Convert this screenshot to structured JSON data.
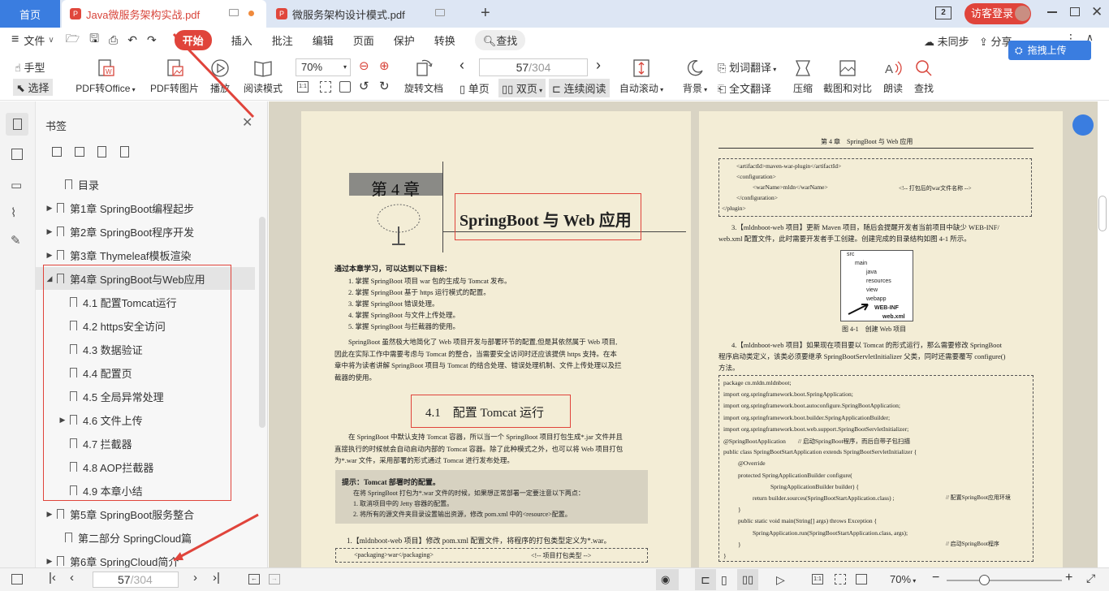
{
  "tabs": {
    "home": "首页",
    "active": "Java微服务架构实战.pdf",
    "second": "微服务架构设计模式.pdf",
    "badge": "2",
    "login": "访客登录"
  },
  "menu": {
    "file": "文件",
    "start": "开始",
    "insert": "插入",
    "annotate": "批注",
    "edit": "编辑",
    "page": "页面",
    "protect": "保护",
    "convert": "转换",
    "search": "查找",
    "unsynced": "未同步",
    "share": "分享"
  },
  "toolbar": {
    "hand": "手型",
    "select": "选择",
    "pdf_office": "PDF转Office",
    "pdf_image": "PDF转图片",
    "play": "播放",
    "read_mode": "阅读模式",
    "zoom": "70%",
    "rotate": "旋转文档",
    "page_current": "57",
    "page_total": "/304",
    "single": "单页",
    "double": "双页",
    "continuous": "连续阅读",
    "auto_scroll": "自动滚动",
    "background": "背景",
    "word_translate": "划词翻译",
    "full_translate": "全文翻译",
    "compress": "压缩",
    "screenshot_compare": "截图和对比",
    "read_aloud": "朗读",
    "find": "查找",
    "drag_upload": "拖拽上传"
  },
  "sidebar": {
    "title": "书签",
    "items": [
      {
        "label": "目录"
      },
      {
        "label": "第1章 SpringBoot编程起步"
      },
      {
        "label": "第2章 SpringBoot程序开发"
      },
      {
        "label": "第3章 Thymeleaf模板渲染"
      },
      {
        "label": "第4章 SpringBoot与Web应用"
      },
      {
        "label": "4.1 配置Tomcat运行"
      },
      {
        "label": "4.2 https安全访问"
      },
      {
        "label": "4.3 数据验证"
      },
      {
        "label": "4.4 配置页"
      },
      {
        "label": "4.5 全局异常处理"
      },
      {
        "label": "4.6 文件上传"
      },
      {
        "label": "4.7 拦截器"
      },
      {
        "label": "4.8 AOP拦截器"
      },
      {
        "label": "4.9 本章小结"
      },
      {
        "label": "第5章 SpringBoot服务整合"
      },
      {
        "label": "第二部分 SpringCloud篇"
      },
      {
        "label": "第6章 SpringCloud简介"
      }
    ]
  },
  "left_page": {
    "chapter_label": "第 4 章",
    "chapter_title": "SpringBoot 与 Web 应用",
    "goals_intro": "通过本章学习，可以达到以下目标：",
    "goals": [
      "1. 掌握 SpringBoot 项目 war 包的生成与 Tomcat 发布。",
      "2. 掌握 SpringBoot 基于 https 运行模式的配置。",
      "3. 掌握 SpringBoot 错误处理。",
      "4. 掌握 SpringBoot 与文件上传处理。",
      "5. 掌握 SpringBoot 与拦截器的使用。"
    ],
    "intro": [
      "SpringBoot 虽然极大地简化了 Web 项目开发与部署环节的配置,但是其依然属于 Web 项目,",
      "因此在实际工作中需要考虑与 Tomcat 的整合，当需要安全访问时还应该提供 https 支持。在本",
      "章中将为读者讲解 SpringBoot 项目与 Tomcat 的结合处理、错误处理机制、文件上传处理以及拦",
      "截器的使用。"
    ],
    "section": "4.1　配置 Tomcat 运行",
    "section_text": [
      "在 SpringBoot 中默认支持 Tomcat 容器，所以当一个 SpringBoot 项目打包生成*.jar 文件并且",
      "直接执行的时候就会自动启动内部的 Tomcat 容器。除了此种模式之外，也可以将 Web 项目打包",
      "为*.war 文件，采用部署的形式通过 Tomcat 进行发布处理。"
    ],
    "tip_title": "提示：Tomcat 部署时的配置。",
    "tip_lines": [
      "在将 SpringBoot 打包为*.war 文件的时候，如果想正常部署一定要注意以下两点：",
      "1. 取消项目中的 Jetty 容器的配置。",
      "2. 将所有的源文件夹目录设置输出资源，修改 pom.xml 中的<resource>配置。"
    ],
    "step1": "1.【mldnboot-web 项目】修改 pom.xml 配置文件，将程序的打包类型定义为*.war。",
    "code1": "<packaging>war</packaging>",
    "code1_comment": "<!-- 项目打包类型 -->"
  },
  "right_page": {
    "header": "第 4 章　SpringBoot 与 Web 应用",
    "code_top": [
      "<artifactId>maven-war-plugin</artifactId>",
      "<configuration>",
      "<warName>mldn</warName>",
      "</configuration>",
      "</plugin>"
    ],
    "code_top_comment": "<!-- 打包后的war文件名称 -->",
    "step3": [
      "3.【mldnboot-web 项目】更新 Maven 项目，随后会提醒开发者当前项目中缺少 WEB-INF/",
      "web.xml 配置文件，此时需要开发者手工创建。创建完成的目录结构如图 4-1 所示。"
    ],
    "tree": [
      "src",
      "main",
      "java",
      "resources",
      "view",
      "webapp",
      "WEB-INF",
      "web.xml"
    ],
    "figure_caption": "图 4-1　创建 Web 项目",
    "step4": [
      "4.【mldnboot-web 项目】如果现在项目要以 Tomcat 的形式运行，那么需要修改 SpringBoot",
      "程序启动类定义，该类必须要继承 SpringBootServletInitializer 父类，同时还需要覆写 configure()",
      "方法。"
    ],
    "code": [
      "package cn.mldn.mldnboot;",
      "import org.springframework.boot.SpringApplication;",
      "import org.springframework.boot.autoconfigure.SpringBootApplication;",
      "import org.springframework.boot.builder.SpringApplicationBuilder;",
      "import org.springframework.boot.web.support.SpringBootServletInitializer;",
      "@SpringBootApplication　　// 启动SpringBoot程序，而后自带子包扫描",
      "public class SpringBootStartApplication extends SpringBootServletInitializer {",
      "@Override",
      "protected SpringApplicationBuilder configure(",
      "SpringApplicationBuilder builder) {",
      "return builder.sources(SpringBootStartApplication.class) ;",
      "}",
      "public static void main(String[] args) throws Exception {",
      "SpringApplication.run(SpringBootStartApplication.class, args);",
      "}",
      "}"
    ],
    "code_comment1": "// 配置SpringBoot应用环境",
    "code_comment2": "// 启动SpringBoot程序"
  },
  "statusbar": {
    "page_current": "57",
    "page_total": "/304",
    "zoom": "70%"
  }
}
